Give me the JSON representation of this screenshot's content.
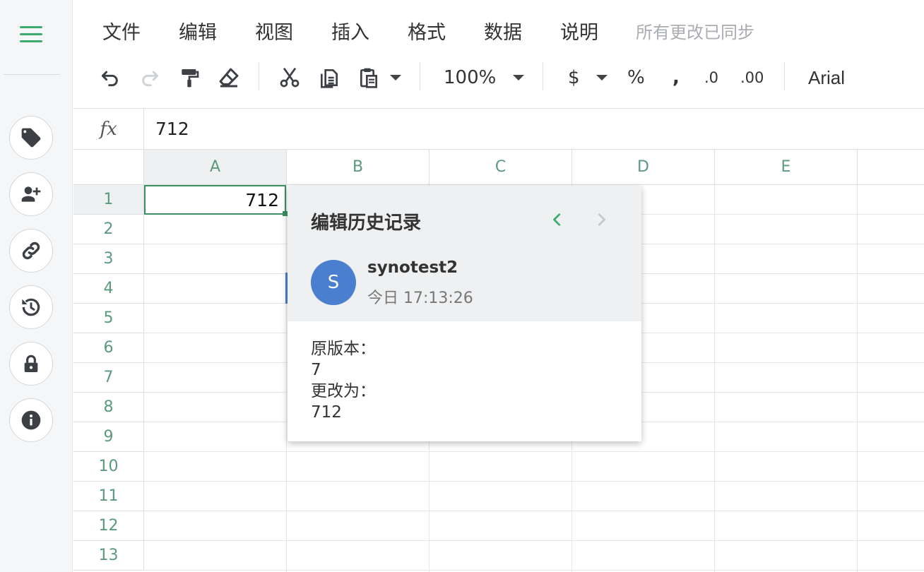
{
  "menu": {
    "items": [
      "文件",
      "编辑",
      "视图",
      "插入",
      "格式",
      "数据",
      "说明"
    ],
    "sync_status": "所有更改已同步"
  },
  "toolbar": {
    "zoom": "100%",
    "currency": "$",
    "percent": "%",
    "comma": ",",
    "decrease_decimal": ".0",
    "increase_decimal": ".00",
    "font": "Arial"
  },
  "formula_bar": {
    "label": "fx",
    "value": "712"
  },
  "grid": {
    "columns": [
      "A",
      "B",
      "C",
      "D",
      "E"
    ],
    "rows": [
      "1",
      "2",
      "3",
      "4",
      "5",
      "6",
      "7",
      "8",
      "9",
      "10",
      "11",
      "12",
      "13"
    ],
    "selected_cell_value": "712"
  },
  "history_popup": {
    "title": "编辑历史记录",
    "avatar_letter": "S",
    "user": "synotest2",
    "time": "今日 17:13:26",
    "original_label": "原版本：",
    "original_value": "7",
    "changed_label": "更改为：",
    "changed_value": "712"
  },
  "colors": {
    "accent": "#3daa6e",
    "header_text": "#5b9a7c",
    "avatar": "#4a7fd0"
  },
  "icons": {
    "sidebar": [
      "tag-icon",
      "add-user-icon",
      "link-icon",
      "history-icon",
      "lock-icon",
      "info-icon"
    ],
    "toolbar": [
      "undo-icon",
      "redo-icon",
      "paint-format-icon",
      "clear-format-icon",
      "cut-icon",
      "copy-icon",
      "paste-icon"
    ]
  }
}
